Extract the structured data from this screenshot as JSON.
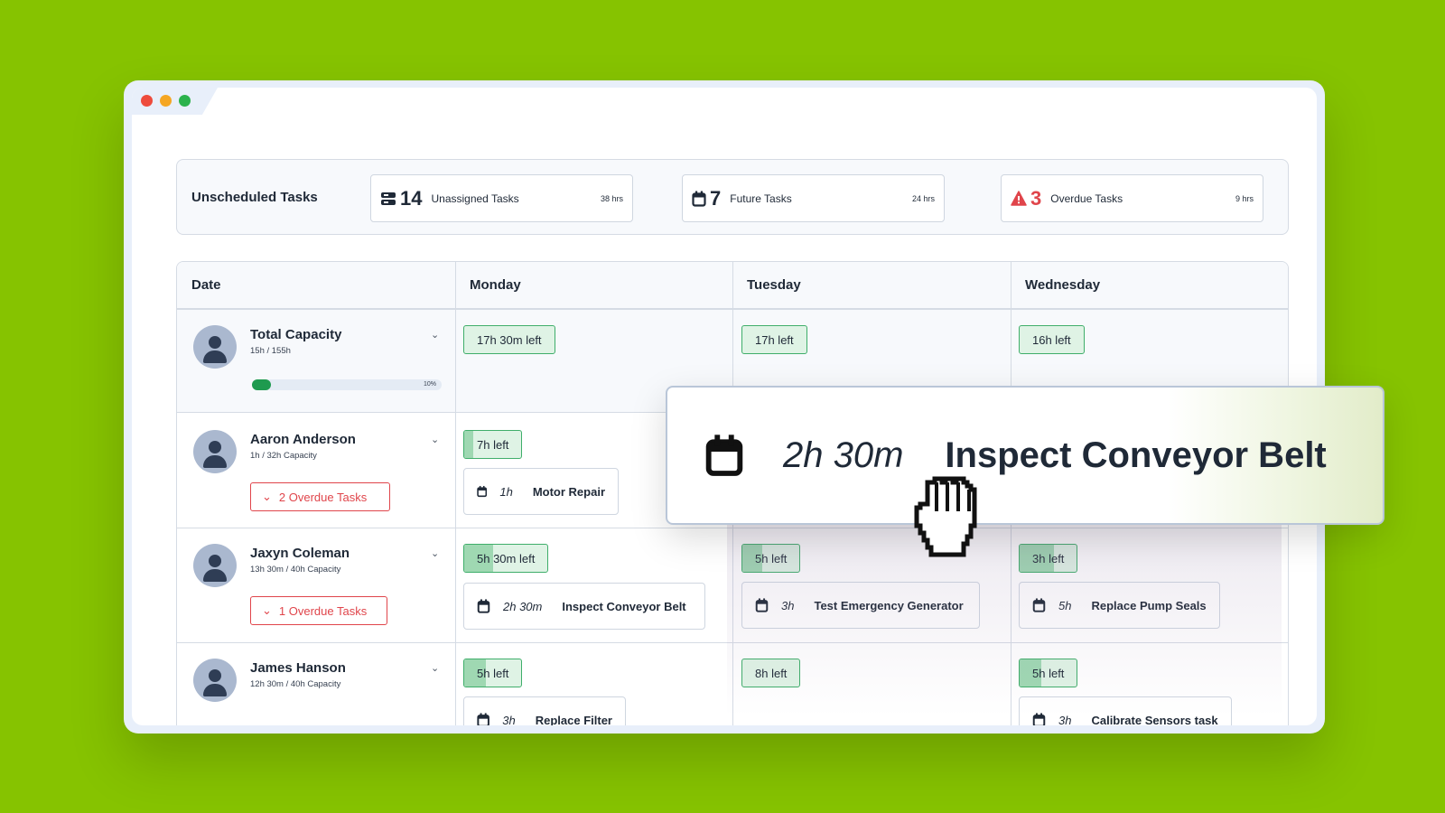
{
  "summary": {
    "title": "Unscheduled Tasks",
    "stats": [
      {
        "count": "14",
        "label": "Unassigned Tasks",
        "hours": "38 hrs",
        "icon": "stack-icon",
        "color": "#1f2937"
      },
      {
        "count": "7",
        "label": "Future Tasks",
        "hours": "24 hrs",
        "icon": "calendar-icon",
        "color": "#1f2937"
      },
      {
        "count": "3",
        "label": "Overdue Tasks",
        "hours": "9 hrs",
        "icon": "warning-icon",
        "color": "#e0454b"
      }
    ]
  },
  "grid": {
    "headers": [
      "Date",
      "Monday",
      "Tuesday",
      "Wednesday"
    ],
    "capacity": {
      "name": "Total Capacity",
      "sub": "15h / 155h",
      "progress": 0.1,
      "progress_label": "10%",
      "left": [
        "17h 30m left",
        "17h left",
        "16h left"
      ]
    },
    "people": [
      {
        "name": "Aaron Anderson",
        "sub": "1h / 32h Capacity",
        "overdue": "2 Overdue Tasks",
        "left": [
          {
            "text": "7h left",
            "fill": 0.15
          }
        ],
        "tasks": [
          {
            "dur": "1h",
            "name": "Motor Repair"
          }
        ]
      },
      {
        "name": "Jaxyn Coleman",
        "sub": "13h 30m / 40h Capacity",
        "overdue": "1 Overdue Tasks",
        "left": [
          {
            "text": "5h 30m left",
            "fill": 0.35
          },
          {
            "text": "5h left",
            "fill": 0.35
          },
          {
            "text": "3h left",
            "fill": 0.6
          }
        ],
        "tasks": [
          {
            "dur": "2h 30m",
            "name": "Inspect Conveyor Belt"
          },
          {
            "dur": "3h",
            "name": "Test Emergency Generator"
          },
          {
            "dur": "5h",
            "name": "Replace Pump Seals"
          }
        ]
      },
      {
        "name": "James Hanson",
        "sub": "12h 30m / 40h Capacity",
        "left": [
          {
            "text": "5h left",
            "fill": 0.38
          },
          {
            "text": "8h left",
            "fill": 0
          },
          {
            "text": "5h left",
            "fill": 0.38
          }
        ],
        "tasks": [
          {
            "dur": "3h",
            "name": "Replace Filter"
          },
          {
            "dur": "3h",
            "name": "Calibrate Sensors task"
          }
        ]
      }
    ]
  },
  "drag_card": {
    "dur": "2h 30m",
    "name": "Inspect Conveyor Belt"
  },
  "colors": {
    "background": "#86c300",
    "accent_green": "#1e9a4f",
    "alert_red": "#e0454b"
  }
}
